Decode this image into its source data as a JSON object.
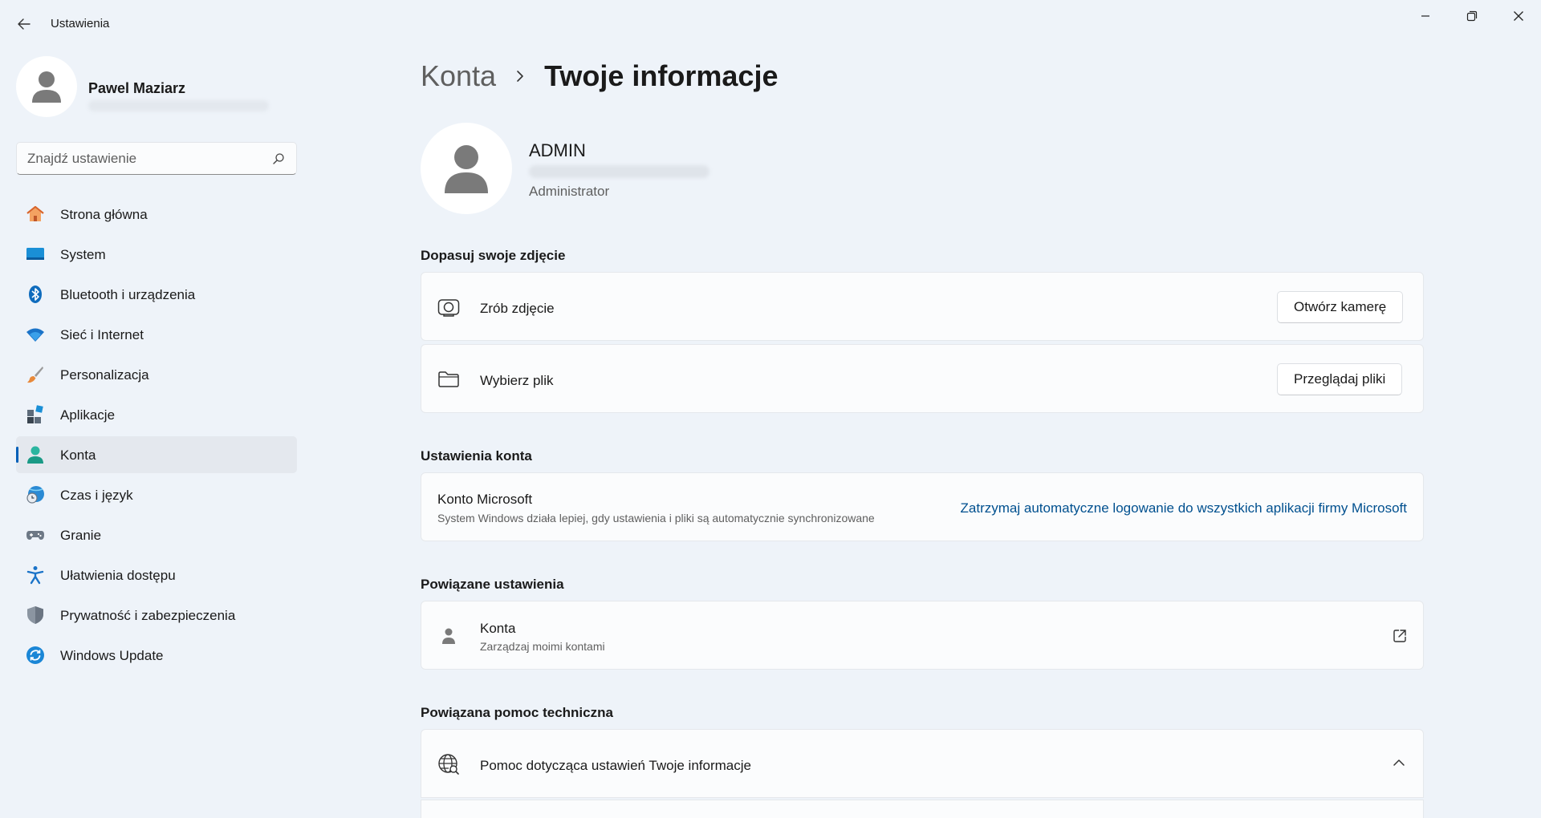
{
  "window": {
    "title": "Ustawienia"
  },
  "sidebar": {
    "user_name": "Pawel Maziarz",
    "search_placeholder": "Znajdź ustawienie",
    "items": [
      {
        "label": "Strona główna",
        "icon": "home-icon"
      },
      {
        "label": "System",
        "icon": "system-icon"
      },
      {
        "label": "Bluetooth i urządzenia",
        "icon": "bluetooth-icon"
      },
      {
        "label": "Sieć i Internet",
        "icon": "wifi-icon"
      },
      {
        "label": "Personalizacja",
        "icon": "brush-icon"
      },
      {
        "label": "Aplikacje",
        "icon": "apps-icon"
      },
      {
        "label": "Konta",
        "icon": "accounts-icon",
        "active": true
      },
      {
        "label": "Czas i język",
        "icon": "time-language-icon"
      },
      {
        "label": "Granie",
        "icon": "gamepad-icon"
      },
      {
        "label": "Ułatwienia dostępu",
        "icon": "accessibility-icon"
      },
      {
        "label": "Prywatność i zabezpieczenia",
        "icon": "shield-icon"
      },
      {
        "label": "Windows Update",
        "icon": "windows-update-icon"
      }
    ]
  },
  "main": {
    "breadcrumb": {
      "parent": "Konta",
      "current": "Twoje informacje"
    },
    "profile": {
      "name": "ADMIN",
      "role": "Administrator"
    },
    "photo_section": {
      "title": "Dopasuj swoje zdjęcie",
      "take_photo_label": "Zrób zdjęcie",
      "take_photo_button": "Otwórz kamerę",
      "choose_file_label": "Wybierz plik",
      "choose_file_button": "Przeglądaj pliki"
    },
    "account_section": {
      "title": "Ustawienia konta",
      "ms_account_label": "Konto Microsoft",
      "ms_account_desc": "System Windows działa lepiej, gdy ustawienia i pliki są automatycznie synchronizowane",
      "ms_account_link": "Zatrzymaj automatyczne logowanie do wszystkich aplikacji firmy Microsoft"
    },
    "related_section": {
      "title": "Powiązane ustawienia",
      "accounts_label": "Konta",
      "accounts_desc": "Zarządzaj moimi kontami"
    },
    "help_section": {
      "title": "Powiązana pomoc techniczna",
      "help_label": "Pomoc dotycząca ustawień Twoje informacje"
    }
  },
  "colors": {
    "background": "#eef3f9",
    "accent": "#005fb8",
    "link": "#00508f"
  }
}
